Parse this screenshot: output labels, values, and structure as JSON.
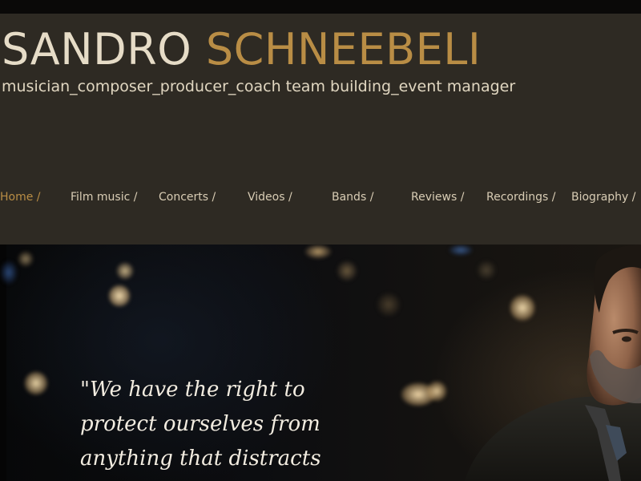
{
  "header": {
    "first_name": "SANDRO",
    "last_name": "SCHNEEBELI",
    "tagline": "musician_composer_producer_coach team building_event manager"
  },
  "nav": {
    "items": [
      {
        "label": "Home /",
        "active": true
      },
      {
        "label": "Film music /",
        "active": false
      },
      {
        "label": "Concerts /",
        "active": false
      },
      {
        "label": "Videos /",
        "active": false
      },
      {
        "label": "Bands /",
        "active": false
      },
      {
        "label": "Reviews /",
        "active": false
      },
      {
        "label": "Recordings /",
        "active": false
      },
      {
        "label": "Biography /",
        "active": false
      }
    ]
  },
  "hero": {
    "quote_lines": [
      "\"We have the right to",
      "protect ourselves from",
      "anything that distracts"
    ]
  },
  "colors": {
    "header_background": "#2e2a23",
    "accent_gold": "#b98d45",
    "text_light": "#e6dcc7"
  }
}
